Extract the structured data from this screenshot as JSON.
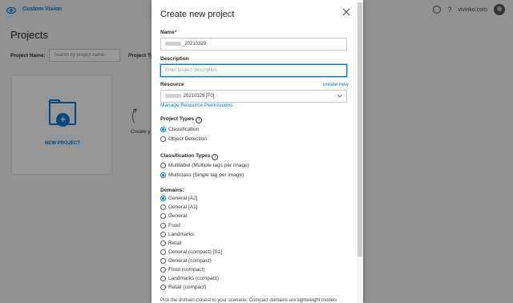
{
  "app": {
    "name": "Custom Vision",
    "user": "vivinko.com"
  },
  "page": {
    "title": "Projects",
    "filter_label": "Project Name:",
    "search_placeholder": "Search by project name",
    "project_types_label": "Project Ty",
    "new_project_label": "NEW PROJECT",
    "create_hint": "Create y"
  },
  "dialog": {
    "title": "Create new project",
    "name": {
      "label": "Name",
      "required_mark": "*",
      "value": "_20210329"
    },
    "description": {
      "label": "Description",
      "placeholder": "Enter project description"
    },
    "resource": {
      "label": "Resource",
      "create_new": "create new",
      "value": "20210329 [F0]",
      "manage_link": "Manage Resource Permissions"
    },
    "project_types": {
      "label": "Project Types",
      "options": [
        "Classification",
        "Object Detection"
      ],
      "selected": "Classification"
    },
    "classification_types": {
      "label": "Classification Types",
      "options": [
        "Multilabel (Multiple tags per image)",
        "Multiclass (Single tag per image)"
      ],
      "selected": "Multiclass (Single tag per image)"
    },
    "domains": {
      "label": "Domains:",
      "options": [
        "General [A2]",
        "General [A1]",
        "General",
        "Food",
        "Landmarks",
        "Retail",
        "General (compact) [S1]",
        "General (compact)",
        "Food (compact)",
        "Landmarks (compact)",
        "Retail (compact)"
      ],
      "selected": "General [A2]"
    },
    "hint": "Pick the domain closest to your scenario. Compact domains are lightweight models"
  },
  "colors": {
    "accent": "#0078d4",
    "required": "#c50f1f"
  }
}
